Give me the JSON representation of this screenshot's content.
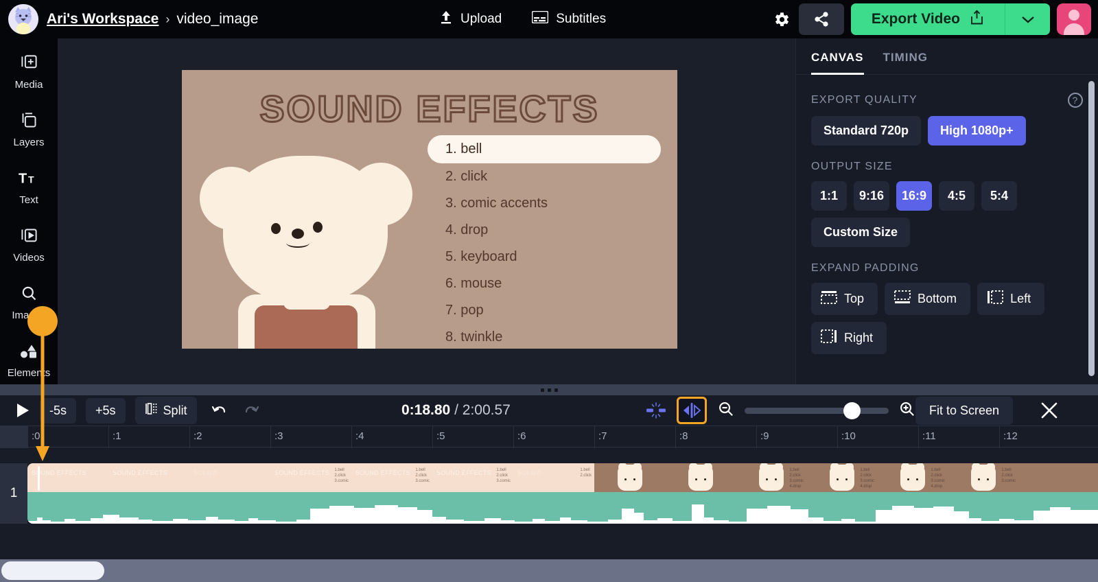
{
  "header": {
    "workspace": "Ari's Workspace",
    "separator": "›",
    "project": "video_image",
    "upload_label": "Upload",
    "subtitles_label": "Subtitles",
    "export_label": "Export Video",
    "icons": {
      "logo": "cat-avatar-icon",
      "upload": "upload-icon",
      "subtitles": "subtitles-icon",
      "settings": "gear-icon",
      "share": "share-icon",
      "export": "export-share-icon",
      "caret": "chevron-down-icon",
      "user": "user-avatar-icon"
    }
  },
  "sidebar": {
    "items": [
      {
        "label": "Media",
        "icon": "media-add-icon"
      },
      {
        "label": "Layers",
        "icon": "layers-icon"
      },
      {
        "label": "Text",
        "icon": "text-icon"
      },
      {
        "label": "Videos",
        "icon": "video-icon"
      },
      {
        "label": "Images",
        "icon": "search-image-icon"
      },
      {
        "label": "Elements",
        "icon": "shapes-icon"
      }
    ]
  },
  "canvas": {
    "slide_title": "SOUND EFFECTS",
    "list": [
      "1. bell",
      "2. click",
      "3. comic accents",
      "4. drop",
      "5. keyboard",
      "6. mouse",
      "7. pop",
      "8. twinkle"
    ],
    "highlighted_index": 0,
    "background_color": "#b79c8c",
    "text_color": "#53372c",
    "highlight_color": "#fdf6ee"
  },
  "right_panel": {
    "tabs": [
      {
        "label": "CANVAS",
        "active": true
      },
      {
        "label": "TIMING",
        "active": false
      }
    ],
    "export_quality": {
      "title": "EXPORT QUALITY",
      "help_icon": "help-circle-icon",
      "options": [
        {
          "label": "Standard 720p",
          "active": false
        },
        {
          "label": "High 1080p+",
          "active": true
        }
      ]
    },
    "output_size": {
      "title": "OUTPUT SIZE",
      "options": [
        {
          "label": "1:1",
          "active": false
        },
        {
          "label": "9:16",
          "active": false
        },
        {
          "label": "16:9",
          "active": true
        },
        {
          "label": "4:5",
          "active": false
        },
        {
          "label": "5:4",
          "active": false
        }
      ],
      "custom_label": "Custom Size"
    },
    "expand_padding": {
      "title": "EXPAND PADDING",
      "options": [
        {
          "label": "Top",
          "icon": "padding-top-icon"
        },
        {
          "label": "Bottom",
          "icon": "padding-bottom-icon"
        },
        {
          "label": "Left",
          "icon": "padding-left-icon"
        },
        {
          "label": "Right",
          "icon": "padding-right-icon"
        }
      ]
    },
    "accent_color": "#5b63e8"
  },
  "playback": {
    "play_icon": "play-icon",
    "back_label": "-5s",
    "forward_label": "+5s",
    "split_label": "Split",
    "split_icon": "split-icon",
    "undo_icon": "undo-icon",
    "redo_icon": "redo-icon",
    "current_time": "0:18.80",
    "time_separator": "/",
    "total_time": "2:00.57",
    "close_gap_icon": "close-gap-icon",
    "expand-gap_icon": "expand-gap-icon",
    "zoom_out_icon": "zoom-out-icon",
    "zoom_in_icon": "zoom-in-icon",
    "zoom_value": 72,
    "fit_label": "Fit to Screen",
    "close_icon": "close-icon",
    "highlight_color": "#f5a524"
  },
  "timeline": {
    "ticks": [
      ":0",
      ":1",
      ":2",
      ":3",
      ":4",
      ":5",
      ":6",
      ":7",
      ":8",
      ":9",
      ":10",
      ":11",
      ":12"
    ],
    "track_number": "1",
    "waveform_color": "#6bbfa8",
    "clip_color": "#9c7a64"
  },
  "annotation": {
    "color": "#f5a524",
    "shape": "circle-with-arrow"
  }
}
